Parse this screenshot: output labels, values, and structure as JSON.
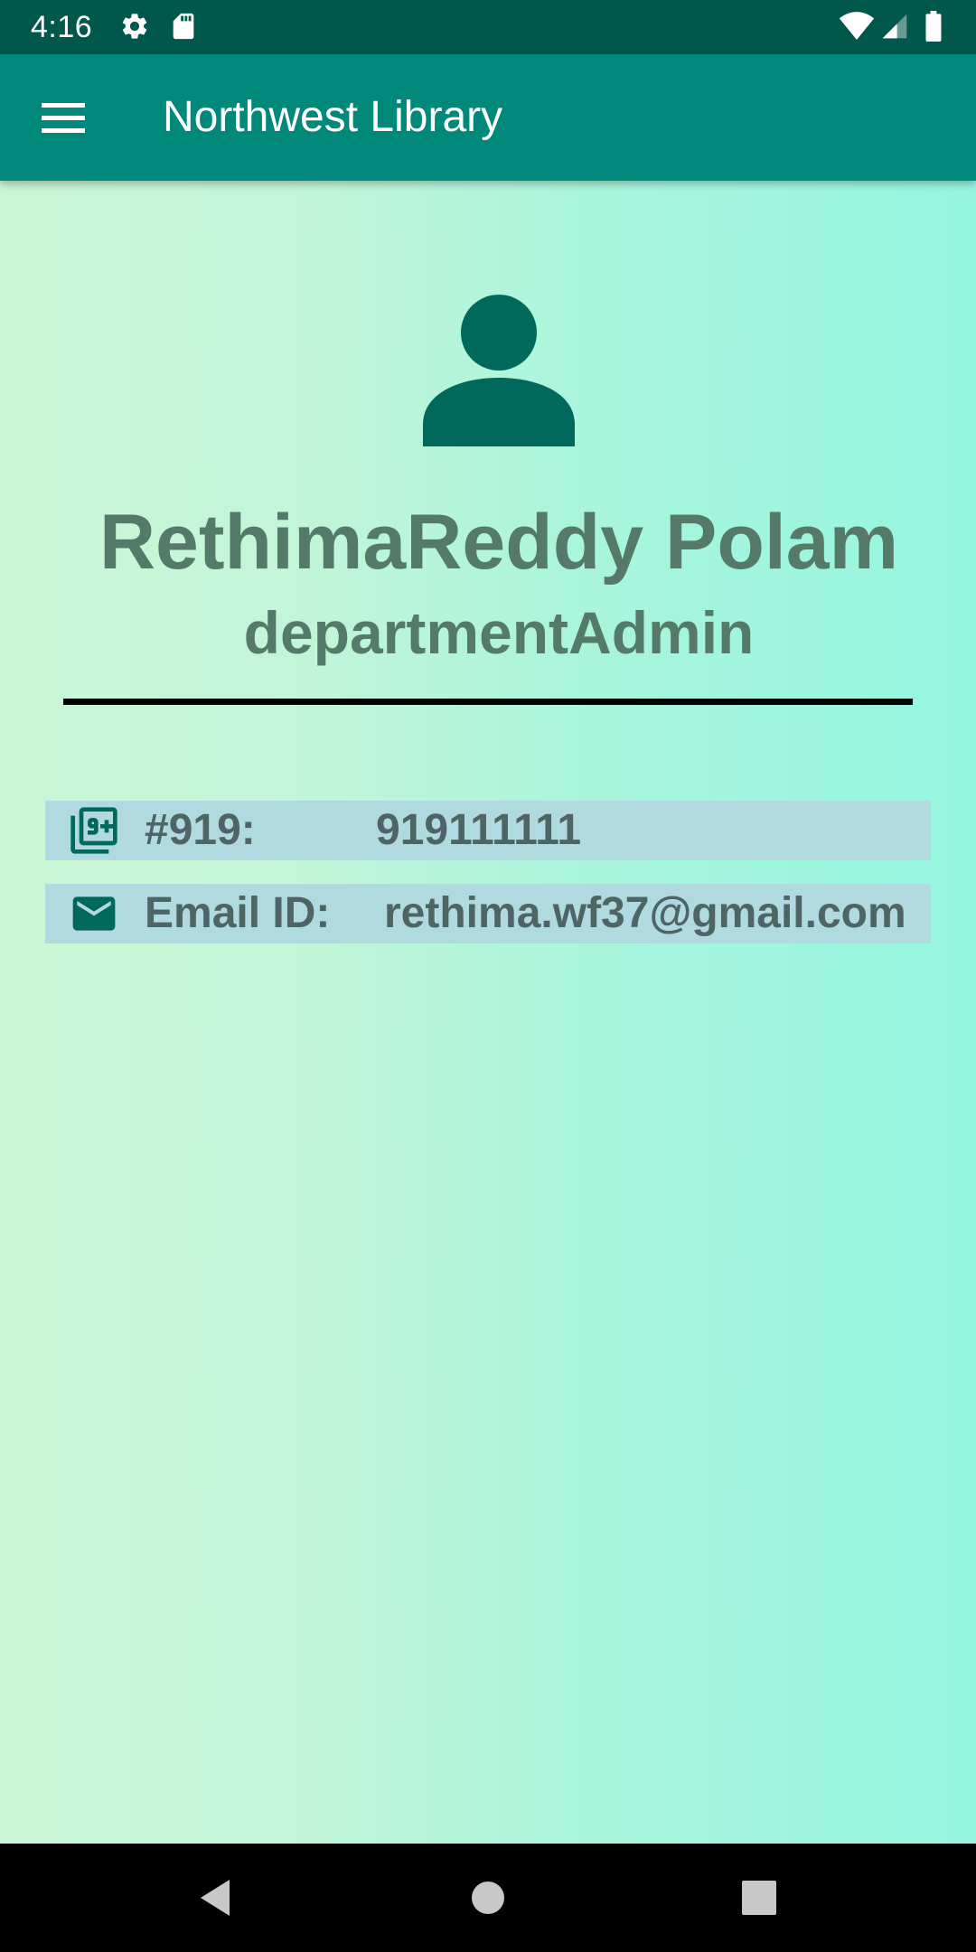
{
  "status_bar": {
    "time": "4:16",
    "icons_left": [
      "settings-icon",
      "sd-card-icon"
    ],
    "icons_right": [
      "wifi-icon",
      "cell-signal-icon",
      "battery-icon"
    ]
  },
  "app_bar": {
    "title": "Northwest Library",
    "menu_icon": "menu-icon"
  },
  "profile": {
    "avatar_icon": "person-icon",
    "name": "RethimaReddy Polam",
    "role": "departmentAdmin"
  },
  "details": {
    "phone": {
      "icon": "filter-9-plus-icon",
      "label": "#919:",
      "value": "919111111"
    },
    "email": {
      "icon": "mail-icon",
      "label": "Email ID:",
      "value": "rethima.wf37@gmail.com"
    }
  },
  "navigation": {
    "buttons": [
      "back-icon",
      "home-icon",
      "recents-icon"
    ]
  },
  "colors": {
    "status_bar": "#00574b",
    "app_bar": "#00897b",
    "icon_green": "#00695c",
    "text": "#567a6a",
    "row_background": "#b0dae0"
  }
}
